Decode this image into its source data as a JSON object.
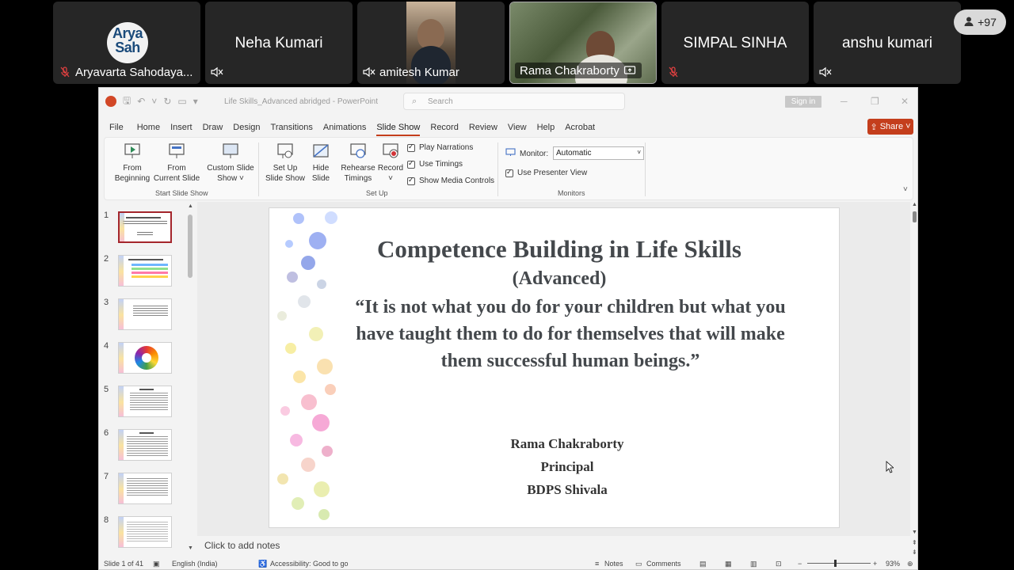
{
  "participants": [
    {
      "name": "Aryavarta Sahodaya...",
      "logo_text": "Arya Sah",
      "mic": "muted-red"
    },
    {
      "name": "Neha Kumari",
      "mic": "speaker-off"
    },
    {
      "name": "amitesh Kumar",
      "mic": "speaker-off"
    },
    {
      "name": "Rama Chakraborty",
      "mic": "screen-share"
    },
    {
      "name": "SIMPAL SINHA",
      "mic": "muted-red"
    },
    {
      "name": "anshu kumari",
      "mic": "speaker-off"
    }
  ],
  "more_participants": "+97",
  "ppt": {
    "doc_title": "Life Skills_Advanced abridged  -  PowerPoint",
    "search_placeholder": "Search",
    "signin": "Sign in",
    "menu": [
      "File",
      "Home",
      "Insert",
      "Draw",
      "Design",
      "Transitions",
      "Animations",
      "Slide Show",
      "Record",
      "Review",
      "View",
      "Help",
      "Acrobat"
    ],
    "active_menu": "Slide Show",
    "share_label": "Share",
    "ribbon": {
      "from_beginning": [
        "From",
        "Beginning"
      ],
      "from_current": [
        "From",
        "Current Slide"
      ],
      "custom_show": [
        "Custom Slide",
        "Show ˅"
      ],
      "group_start": "Start Slide Show",
      "setup_show": [
        "Set Up",
        "Slide Show"
      ],
      "hide_slide": [
        "Hide",
        "Slide"
      ],
      "rehearse": [
        "Rehearse",
        "Timings"
      ],
      "record": [
        "Record",
        "˅"
      ],
      "play_narrations": "Play Narrations",
      "use_timings": "Use Timings",
      "show_media": "Show Media Controls",
      "group_setup": "Set Up",
      "monitor_label": "Monitor:",
      "monitor_value": "Automatic",
      "presenter_view": "Use Presenter View",
      "group_monitors": "Monitors"
    },
    "slide_numbers": [
      "1",
      "2",
      "3",
      "4",
      "5",
      "6",
      "7",
      "8"
    ],
    "slide": {
      "title": "Competence Building in Life Skills",
      "subtitle": "(Advanced)",
      "quote_lines": [
        "“It is not what you do for your children but what you",
        "have taught them to do for themselves that will make",
        "them successful human beings.”"
      ],
      "author": "Rama Chakraborty",
      "role": "Principal",
      "school": "BDPS Shivala"
    },
    "notes_placeholder": "Click to add notes",
    "status": {
      "slide_counter": "Slide 1 of 41",
      "language": "English (India)",
      "accessibility": "Accessibility: Good to go",
      "notes": "Notes",
      "comments": "Comments",
      "zoom": "93%"
    }
  },
  "colors": {
    "accent": "#c43e1c",
    "selected_thumb": "#a4262c",
    "tile_bg": "#262626"
  }
}
